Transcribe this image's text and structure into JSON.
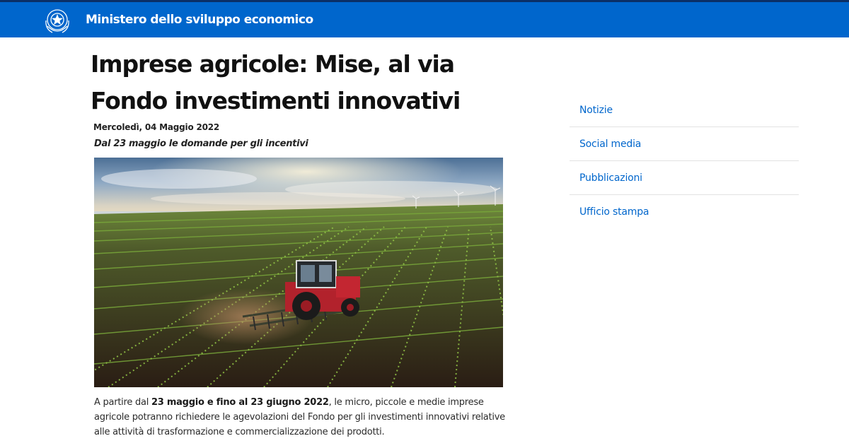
{
  "header": {
    "site_title": "Ministero dello sviluppo economico",
    "emblem_icon": "italian-republic-emblem-icon",
    "background_color": "#0066cc"
  },
  "article": {
    "headline_line1": "Imprese agricole: Mise, al via",
    "headline_line2": "Fondo investimenti innovativi",
    "date": "Mercoledì, 04 Maggio 2022",
    "subtitle": "Dal 23 maggio le domande per gli incentivi",
    "body": {
      "part1": "A partire dal ",
      "bold1": "23 maggio e fino al 23 giugno 2022",
      "part2": ", le micro, piccole e medie imprese agricole potranno richiedere le agevolazioni del Fondo per gli investimenti innovativi relative alle attività di trasformazione e commercializzazione dei prodotti."
    }
  },
  "sidebar": {
    "items": [
      {
        "label": "Notizie"
      },
      {
        "label": "Social media"
      },
      {
        "label": "Pubblicazioni"
      },
      {
        "label": "Ufficio stampa"
      }
    ],
    "link_color": "#0066cc"
  }
}
